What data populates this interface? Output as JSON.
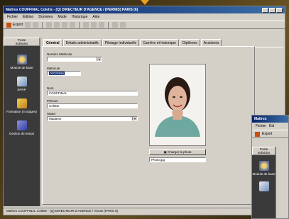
{
  "main_window": {
    "title": "Maîtres COUFFINAL Colette - [Q] DIRECTEUR D'AGENCE / [PERMIS] PARIS (6)",
    "menu": [
      "Fichier",
      "Édition",
      "Données",
      "Mode",
      "Historique",
      "Aide"
    ],
    "toolbar": {
      "export_label": "Export"
    },
    "sidebar": {
      "header": [
        "Poste",
        "Individus"
      ],
      "items": [
        {
          "label": "Module de base",
          "icon": "user-module-icon"
        },
        {
          "label": "SPRP",
          "icon": "document-icon"
        },
        {
          "label": "Formation (m.stages)",
          "icon": "training-icon"
        },
        {
          "label": "Gestion de temps",
          "icon": "clock-icon"
        }
      ]
    },
    "tabs": [
      "Général",
      "Détails administratifs",
      "Pilotage Individuelle",
      "Carrière et historique",
      "Diplômes",
      "Accidents"
    ],
    "form": {
      "matricule_label": "Numéro Matricule",
      "matricule_value": "",
      "nom_usage_label": "Matricule",
      "nom_usage_value": "00028596",
      "nom_label": "Nom",
      "nom_value": "COUFFINAL",
      "prenom_label": "Prénom",
      "prenom_value": "Colette",
      "statut_label": "Statut",
      "statut_value": "Madame"
    },
    "photo": {
      "change_button": "Charger la photo",
      "filename": "Photo.jpg"
    },
    "status": "Maîtres COUFFINAL Colette - (Q) DIRECTEUR D'AGENCE / VOUS (PARIS 6)"
  },
  "second_window": {
    "title": "Maîtres",
    "menu": [
      "Fichier",
      "Édi"
    ],
    "export_label": "Export",
    "sidebar_header": [
      "Poste",
      "Individus"
    ],
    "items": [
      {
        "label": "Module de base"
      }
    ]
  },
  "colors": {
    "titlebar": "#0a246a",
    "background": "#4a3a18",
    "pointer": "#e8a020"
  }
}
